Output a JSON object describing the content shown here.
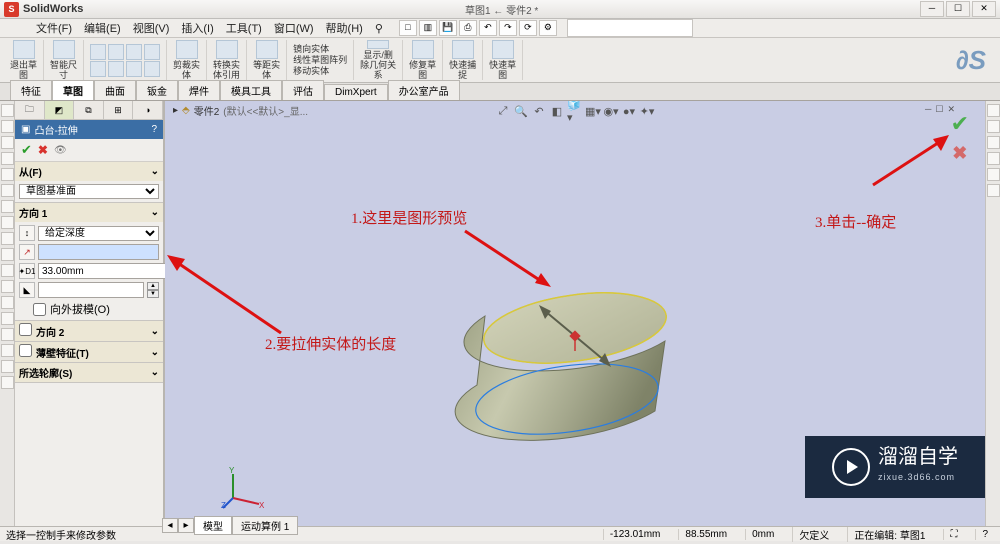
{
  "app": {
    "name": "SolidWorks",
    "doc_title": "草图1 ← 零件2 *"
  },
  "menus": [
    "文件(F)",
    "编辑(E)",
    "视图(V)",
    "插入(I)",
    "工具(T)",
    "窗口(W)",
    "帮助(H)"
  ],
  "ribbon": [
    "退出草\n图",
    "智能尺\n寸",
    "",
    "剪裁实\n体",
    "转换实\n体引用",
    "等距实\n体",
    "",
    "线性草图阵列",
    "",
    "显示/删\n除几何关\n系",
    "修复草\n图",
    "快速捕\n捉",
    "快速草\n图"
  ],
  "ribbon_sub": [
    "镜向实体",
    "线性草图阵列",
    "移动实体"
  ],
  "tabs": [
    "特征",
    "草图",
    "曲面",
    "钣金",
    "焊件",
    "模具工具",
    "评估",
    "DimXpert",
    "办公室产品"
  ],
  "active_tab": "草图",
  "pm": {
    "title": "凸台-拉伸",
    "from": {
      "header": "从(F)",
      "plane": "草图基准面"
    },
    "dir1": {
      "header": "方向 1",
      "endcond": "给定深度",
      "depth": "33.00mm",
      "draft_on": "向外拔模(O)"
    },
    "dir2": {
      "header": "方向 2"
    },
    "thin": {
      "header": "薄壁特征(T)"
    },
    "contours": {
      "header": "所选轮廓(S)"
    }
  },
  "breadcrumb": {
    "a": "零件2",
    "b": "(默认<<默认>_显..."
  },
  "annotations": {
    "a1": "1.这里是图形预览",
    "a2": "2.要拉伸实体的长度",
    "a3": "3.单击--确定"
  },
  "view_tabs": [
    "模型",
    "运动算例 1"
  ],
  "status": {
    "hint": "选择一控制手来修改参数",
    "coord": "-123.01mm",
    "coord2": "88.55mm",
    "coord3": "0mm",
    "def": "欠定义",
    "mode": "正在编辑: 草图1"
  },
  "watermark": {
    "main": "溜溜自学",
    "sub": "zixue.3d66.com"
  }
}
